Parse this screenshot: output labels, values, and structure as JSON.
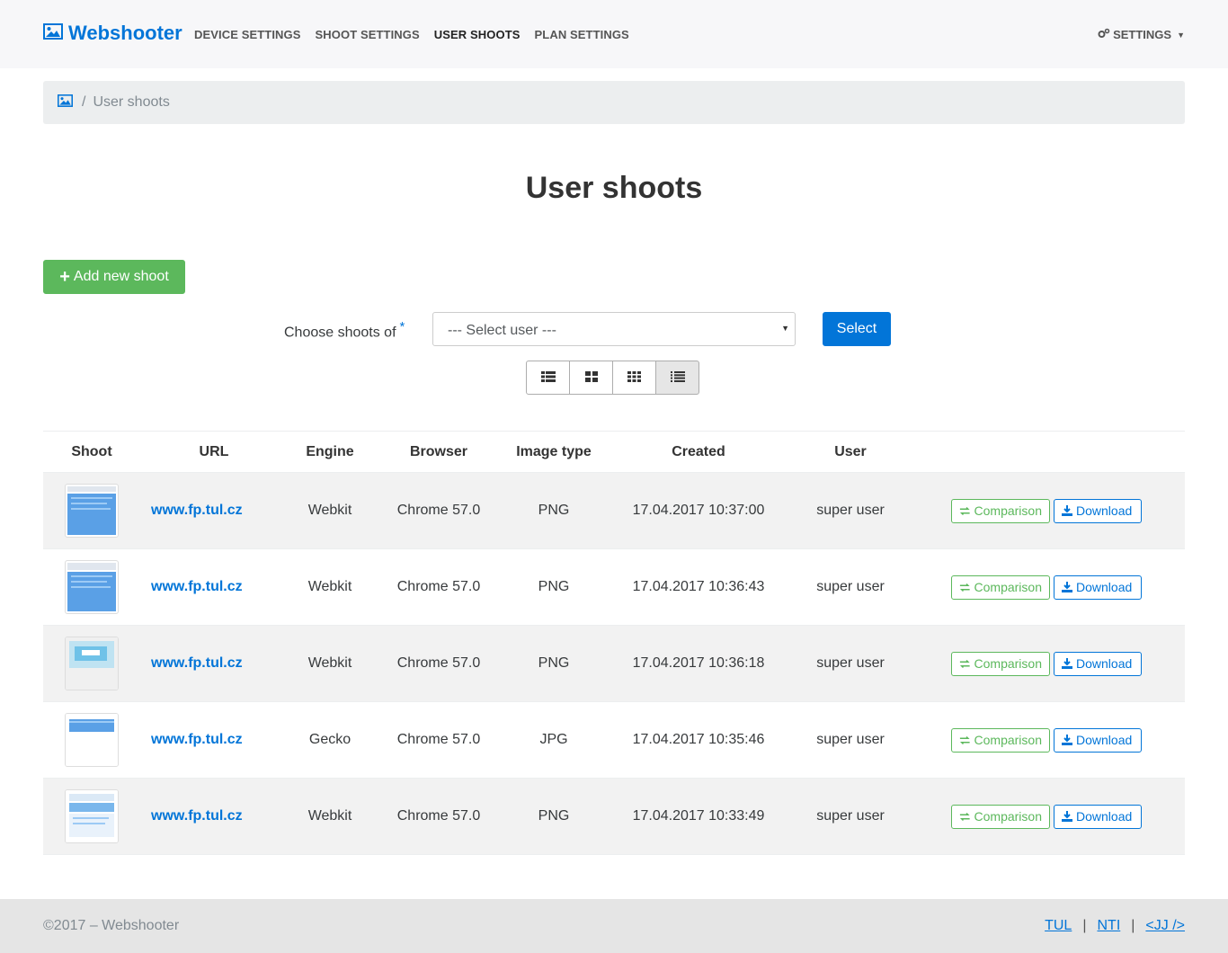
{
  "brand": {
    "name": "Webshooter",
    "icon": "picture-icon"
  },
  "nav": {
    "items": [
      {
        "label": "DEVICE SETTINGS",
        "active": false
      },
      {
        "label": "SHOOT SETTINGS",
        "active": false
      },
      {
        "label": "USER SHOOTS",
        "active": true
      },
      {
        "label": "PLAN SETTINGS",
        "active": false
      }
    ],
    "settings_label": "SETTINGS"
  },
  "breadcrumb": {
    "home_icon": "picture-icon",
    "separator": "/",
    "current": "User shoots"
  },
  "page_title": "User shoots",
  "add_button": {
    "label": "Add new shoot"
  },
  "filter": {
    "label": "Choose shoots of",
    "required_mark": "*",
    "select_value": "--- Select user ---",
    "select_button": "Select"
  },
  "view_modes": [
    "list-icon",
    "grid-2-icon",
    "grid-3-icon",
    "details-list-icon"
  ],
  "table": {
    "headers": [
      "Shoot",
      "URL",
      "Engine",
      "Browser",
      "Image type",
      "Created",
      "User",
      ""
    ],
    "rows": [
      {
        "url": "www.fp.tul.cz",
        "engine": "Webkit",
        "browser": "Chrome 57.0",
        "type": "PNG",
        "created": "17.04.2017 10:37:00",
        "user": "super user"
      },
      {
        "url": "www.fp.tul.cz",
        "engine": "Webkit",
        "browser": "Chrome 57.0",
        "type": "PNG",
        "created": "17.04.2017 10:36:43",
        "user": "super user"
      },
      {
        "url": "www.fp.tul.cz",
        "engine": "Webkit",
        "browser": "Chrome 57.0",
        "type": "PNG",
        "created": "17.04.2017 10:36:18",
        "user": "super user"
      },
      {
        "url": "www.fp.tul.cz",
        "engine": "Gecko",
        "browser": "Chrome 57.0",
        "type": "JPG",
        "created": "17.04.2017 10:35:46",
        "user": "super user"
      },
      {
        "url": "www.fp.tul.cz",
        "engine": "Webkit",
        "browser": "Chrome 57.0",
        "type": "PNG",
        "created": "17.04.2017 10:33:49",
        "user": "super user"
      }
    ],
    "comparison_label": "Comparison",
    "download_label": "Download"
  },
  "footer": {
    "copyright": "©2017 – Webshooter",
    "links": [
      "TUL",
      "NTI",
      "<JJ />"
    ]
  },
  "colors": {
    "primary": "#0275d8",
    "success": "#5cb85c",
    "navbar_bg": "#f7f7f9",
    "footer_bg": "#e5e5e5"
  }
}
